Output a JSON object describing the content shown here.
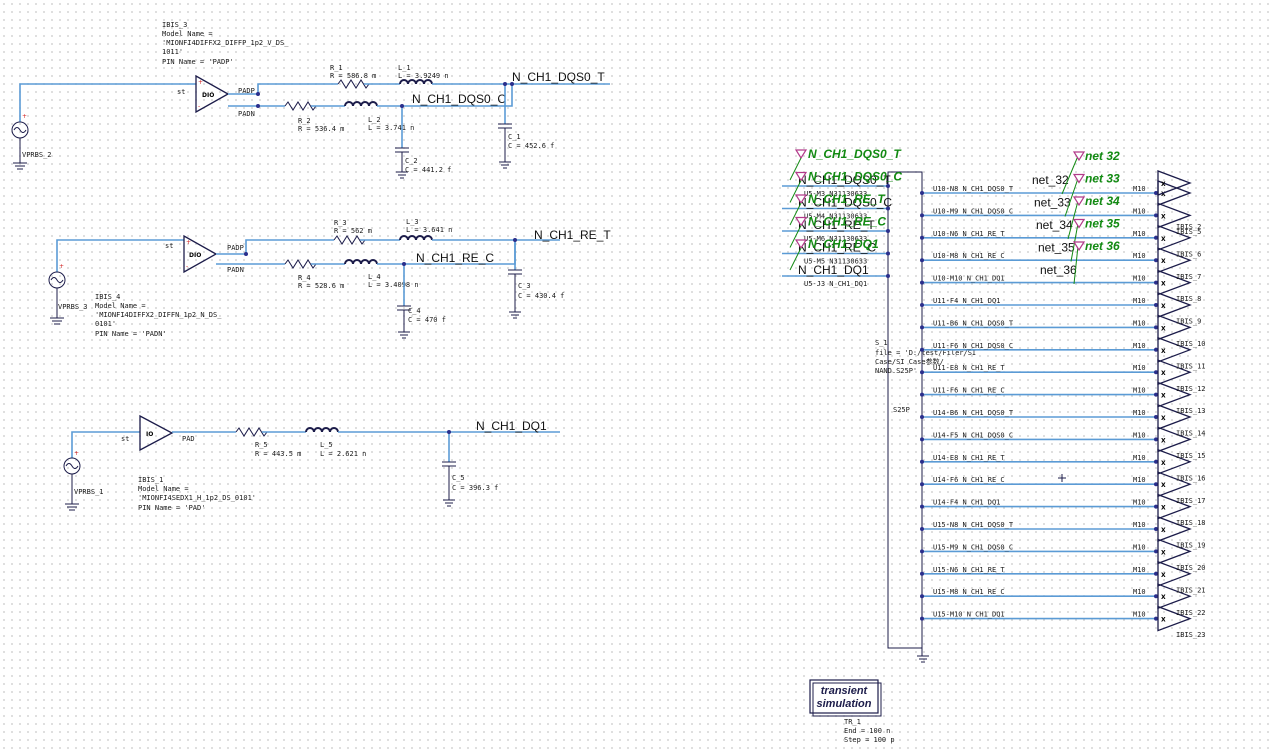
{
  "circuit1": {
    "ibis_label": "IBIS_3",
    "model_name_label": "Model Name =",
    "model_name_l1": "'MIONFI4DIFFX2_DIFFP_1p2_V_DS_",
    "model_name_l2": "1011'",
    "pin_name": "PIN Name = 'PADP'",
    "buf_st": "st",
    "buf_text": "DIO",
    "pin_padp": "PADP",
    "pin_padn": "PADN",
    "source": "VPRBS_2",
    "r1_name": "R_1",
    "r1_val": "R = 586.8 m",
    "l1_name": "L_1",
    "l1_val": "L = 3.9249 n",
    "r2_name": "R_2",
    "r2_val": "R = 536.4 m",
    "l2_name": "L_2",
    "l2_val": "L = 3.741 n",
    "c1_name": "C_1",
    "c1_val": "C = 452.6 f",
    "c2_name": "C_2",
    "c2_val": "C = 441.2 f",
    "net_t": "N_CH1_DQS0_T",
    "net_c": "N_CH1_DQS0_C"
  },
  "circuit2": {
    "ibis_label": "IBIS_4",
    "model_name_label": "Model Name =",
    "model_name_l1": "'MIONFI4DIFFX2_DIFFN_1p2_N_DS_",
    "model_name_l2": "0101'",
    "pin_name": "PIN Name = 'PADN'",
    "buf_st": "st",
    "buf_text": "DIO",
    "pin_padp": "PADP",
    "pin_padn": "PADN",
    "source": "VPRBS_3",
    "r3_name": "R_3",
    "r3_val": "R = 562 m",
    "l3_name": "L_3",
    "l3_val": "L = 3.641 n",
    "r4_name": "R_4",
    "r4_val": "R = 528.6 m",
    "l4_name": "L_4",
    "l4_val": "L = 3.4098 n",
    "c3_name": "C_3",
    "c3_val": "C = 430.4 f",
    "c4_name": "C_4",
    "c4_val": "C = 470 f",
    "net_t": "N_CH1_RE_T",
    "net_c": "N_CH1_RE_C"
  },
  "circuit3": {
    "ibis_label": "IBIS_1",
    "model_name_label": "Model Name =",
    "model_name_l1": "'MIONFI4SEDX1_H_1p2_DS_0101'",
    "pin_name": "PIN Name = 'PAD'",
    "buf_st": "st",
    "buf_text": "IO",
    "pin_pad": "PAD",
    "source": "VPRBS_1",
    "r5_name": "R_5",
    "r5_val": "R = 443.5 m",
    "l5_name": "L_5",
    "l5_val": "L = 2.621 n",
    "c5_name": "C_5",
    "c5_val": "C = 396.3 f",
    "net": "N_CH1_DQ1"
  },
  "sparam": {
    "name": "S_1",
    "file_l1": "file = 'D:/test/Filer/SI",
    "file_l2": "Case/SI Case参数/",
    "file_l3": "NAND.S25P'",
    "center_label": "S25P",
    "left_ports": [
      "U5-M3 N31130633",
      "U5-M4 N31130633",
      "U5-M6 N31130633",
      "U5-M5 N31130633",
      "U5-J3 N_CH1_DQ1"
    ],
    "left_net_labels": [
      "N_CH1_DQS0_T",
      "N_CH1_DQS0_C",
      "N_CH1_RE_T",
      "N_CH1_RE_C",
      "N_CH1_DQ1"
    ],
    "left_green_labels": [
      "N_CH1_DQS0_T",
      "N_CH1_DQS0_C",
      "N_CH1_RE_T",
      "N_CH1_RE_C",
      "N_CH1_DQ1"
    ],
    "right_ports": [
      "U10-N8 N_CH1_DQS0_T",
      "U10-M9 N_CH1_DQS0_C",
      "U10-N6 N_CH1_RE_T",
      "U10-M8 N_CH1_RE_C",
      "U10-M10 N_CH1_DQ1",
      "U11-F4 N_CH1_DQ1",
      "U11-B6 N_CH1_DQS0_T",
      "U11-F6 N_CH1_DQS0_C",
      "U11-E8 N_CH1_RE_T",
      "U11-F6 N_CH1_RE_C",
      "U14-B6 N_CH1_DQS0_T",
      "U14-F5 N_CH1_DQS0_C",
      "U14-E8 N_CH1_RE_T",
      "U14-F6 N_CH1_RE_C",
      "U14-F4 N_CH1_DQ1",
      "U15-N8 N_CH1_DQS0_T",
      "U15-M9 N_CH1_DQS0_C",
      "U15-N6 N_CH1_RE_T",
      "U15-M8 N_CH1_RE_C",
      "U15-M10 N_CH1_DQ1"
    ],
    "model_label": "M10",
    "ibis_labels": [
      "IBIS_5",
      "IBIS_6",
      "IBIS_7",
      "IBIS_8",
      "IBIS_9",
      "IBIS_10",
      "IBIS_11",
      "IBIS_12",
      "IBIS_13",
      "IBIS_14",
      "IBIS_15",
      "IBIS_16",
      "IBIS_17",
      "IBIS_18",
      "IBIS_19",
      "IBIS_20",
      "IBIS_21",
      "IBIS_22",
      "IBIS_23"
    ],
    "top_ibis_label": "IBIS_2",
    "buffer_text": "X"
  },
  "net_labels_right": [
    "net_32",
    "net_33",
    "net_34",
    "net_35",
    "net_36"
  ],
  "green_net_labels_right": [
    "net 32",
    "net 33",
    "net 34",
    "net 35",
    "net 36"
  ],
  "transient": {
    "line1": "transient",
    "line2": "simulation",
    "name": "TR_1",
    "end": "End = 100 n",
    "step": "Step = 100 p"
  },
  "colors": {
    "wire": "#5b9bd5",
    "symbol": "#1c1c4a",
    "probe": "#128a12",
    "marker": "#b23a8a"
  }
}
